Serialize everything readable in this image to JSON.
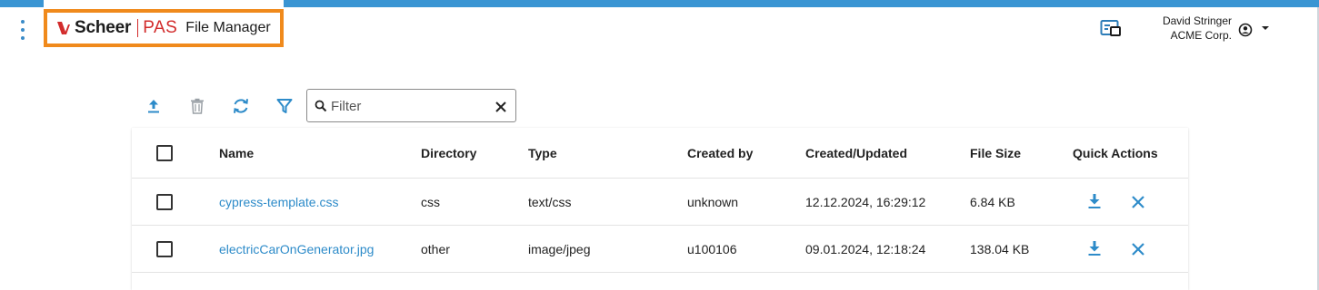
{
  "header": {
    "brand_scheer": "Scheer",
    "brand_pas": "PAS",
    "app_title": "File Manager",
    "user_name": "David Stringer",
    "user_org": "ACME Corp."
  },
  "toolbar": {
    "upload_icon": "upload-icon",
    "delete_icon": "trash-icon",
    "refresh_icon": "refresh-icon",
    "filter_icon": "filter-icon",
    "filter_placeholder": "Filter",
    "filter_value": ""
  },
  "table": {
    "columns": [
      "Name",
      "Directory",
      "Type",
      "Created by",
      "Created/Updated",
      "File Size",
      "Quick Actions"
    ],
    "rows": [
      {
        "name": "cypress-template.css",
        "directory": "css",
        "type": "text/css",
        "created_by": "unknown",
        "updated": "12.12.2024, 16:29:12",
        "size": "6.84 KB"
      },
      {
        "name": "electricCarOnGenerator.jpg",
        "directory": "other",
        "type": "image/jpeg",
        "created_by": "u100106",
        "updated": "09.01.2024, 12:18:24",
        "size": "138.04 KB"
      }
    ]
  },
  "colors": {
    "accent": "#3a95d3",
    "brand_red": "#d22b2b",
    "highlight": "#f08a1c",
    "link": "#2d8bc9"
  }
}
